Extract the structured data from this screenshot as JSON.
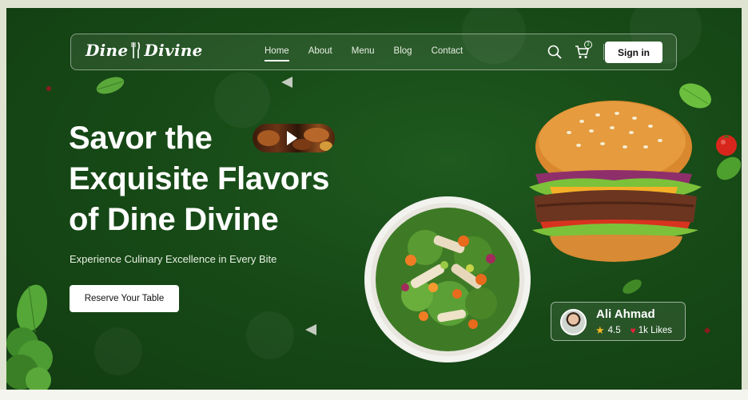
{
  "brand": {
    "name_left": "Dine",
    "name_right": "Divine"
  },
  "nav": {
    "links": [
      {
        "label": "Home",
        "active": true
      },
      {
        "label": "About",
        "active": false
      },
      {
        "label": "Menu",
        "active": false
      },
      {
        "label": "Blog",
        "active": false
      },
      {
        "label": "Contact",
        "active": false
      }
    ],
    "cart_count": "2",
    "signin_label": "Sign in",
    "icons": [
      "search-icon",
      "cart-icon"
    ]
  },
  "hero": {
    "headline_line1": "Savor the",
    "headline_line2": "Exquisite Flavors",
    "headline_line3": "of Dine Divine",
    "subtitle": "Experience Culinary Excellence in Every Bite",
    "cta_label": "Reserve Your Table"
  },
  "profile": {
    "name": "Ali Ahmad",
    "rating": "4.5",
    "likes": "1k Likes"
  },
  "colors": {
    "background": "#174a17",
    "accent": "#ffffff",
    "star": "#f5b920",
    "heart": "#e2253a"
  }
}
